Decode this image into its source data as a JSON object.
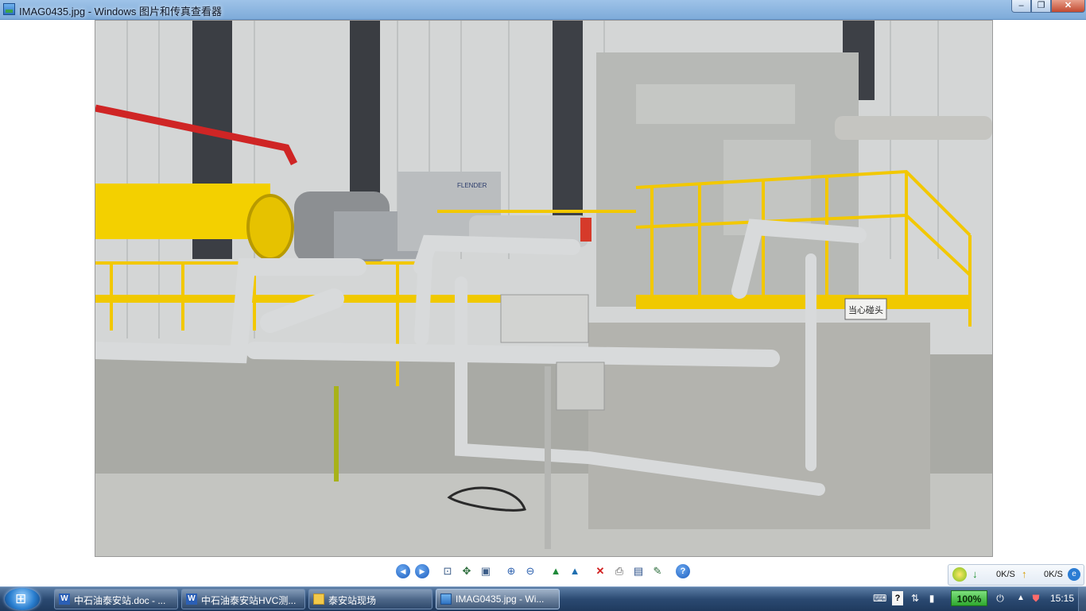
{
  "window": {
    "title": "IMAG0435.jpg - Windows 图片和传真查看器",
    "controls": {
      "minimize": "–",
      "maximize": "❐",
      "close": "✕"
    }
  },
  "photo": {
    "file": "IMAG0435.jpg",
    "sign_text": "当心碰头",
    "brand_text": "FLENDER"
  },
  "toolbar": {
    "buttons": [
      {
        "name": "previous-image",
        "icon": "◀"
      },
      {
        "name": "next-image",
        "icon": "▶"
      },
      {
        "name": "best-fit",
        "icon": "⊡"
      },
      {
        "name": "actual-size",
        "icon": "✥"
      },
      {
        "name": "slideshow",
        "icon": "▣"
      },
      {
        "name": "zoom-in",
        "icon": "⊕"
      },
      {
        "name": "zoom-out",
        "icon": "⊖"
      },
      {
        "name": "rotate-clockwise",
        "icon": "▲"
      },
      {
        "name": "rotate-counterclockwise",
        "icon": "▲"
      },
      {
        "name": "delete",
        "icon": "✕"
      },
      {
        "name": "print",
        "icon": "⎙"
      },
      {
        "name": "copy-to",
        "icon": "▤"
      },
      {
        "name": "open-editor",
        "icon": "✎"
      },
      {
        "name": "help",
        "icon": "?"
      }
    ]
  },
  "network": {
    "down": "0K/S",
    "up": "0K/S"
  },
  "taskbar": {
    "items": [
      {
        "label": "中石油泰安站.doc - ...",
        "icon": "W",
        "active": false
      },
      {
        "label": "中石油泰安站HVC测...",
        "icon": "W",
        "active": false
      },
      {
        "label": "泰安站现场",
        "icon": "folder",
        "active": false
      },
      {
        "label": "IMAG0435.jpg - Wi...",
        "icon": "image",
        "active": true
      }
    ],
    "tray": {
      "zoom": "100%",
      "time": "15:15"
    }
  }
}
